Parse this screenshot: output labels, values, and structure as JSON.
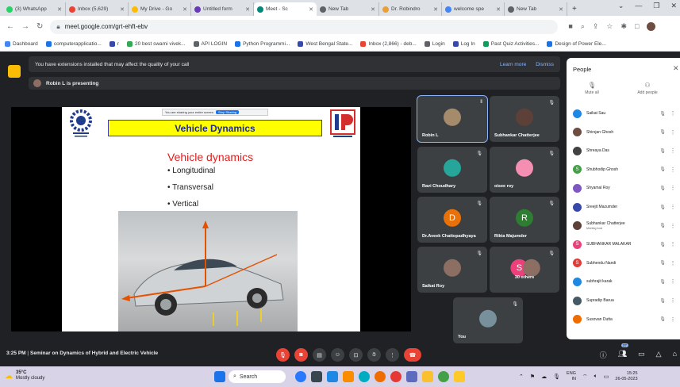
{
  "browser": {
    "tabs": [
      {
        "label": "(3) WhatsApp",
        "color": "#25d366"
      },
      {
        "label": "Inbox (5,629)",
        "color": "#ea4335"
      },
      {
        "label": "My Drive - Go",
        "color": "#fbbc04"
      },
      {
        "label": "Untitled form",
        "color": "#673ab7"
      },
      {
        "label": "Meet - Sc",
        "color": "#00897b",
        "active": true
      },
      {
        "label": "New Tab",
        "color": "#5f6368"
      },
      {
        "label": "Dr. Robindro",
        "color": "#e8a13a"
      },
      {
        "label": "welcome spe",
        "color": "#4285f4"
      },
      {
        "label": "New Tab",
        "color": "#5f6368"
      }
    ],
    "url": "meet.google.com/grt-ehft-ebv",
    "bookmarks": [
      {
        "label": "Dashboard",
        "color": "#4285f4"
      },
      {
        "label": "computerapplicatio...",
        "color": "#1a73e8"
      },
      {
        "label": "r",
        "color": "#3949ab"
      },
      {
        "label": "20 best swami vivek...",
        "color": "#34a853"
      },
      {
        "label": "API LOGIN",
        "color": "#5f6368"
      },
      {
        "label": "Python Programmi...",
        "color": "#1a73e8"
      },
      {
        "label": "West Bengal State...",
        "color": "#3949ab"
      },
      {
        "label": "Inbox (2,866) - deb...",
        "color": "#ea4335"
      },
      {
        "label": "Login",
        "color": "#5f6368"
      },
      {
        "label": "Log In",
        "color": "#3949ab"
      },
      {
        "label": "Past Quiz Activities...",
        "color": "#0f9d58"
      },
      {
        "label": "Design of Power Ele...",
        "color": "#1a73e8"
      }
    ]
  },
  "meet": {
    "warning": "You have extensions installed that may affect the quality of your call",
    "learn_more": "Learn more",
    "dismiss": "Dismiss",
    "presenting": "Robin L is presenting",
    "slide": {
      "banner": "Vehicle Dynamics",
      "title": "Vehicle dynamics",
      "bullets": [
        "Longitudinal",
        "Transversal",
        "Vertical"
      ],
      "share_text": "You are sharing your entire screen",
      "share_btn": "Stop Sharing"
    },
    "tiles": [
      {
        "name": "Robin L",
        "kind": "photo",
        "color": "#a58b6c"
      },
      {
        "name": "Subhankar Chatterjee",
        "kind": "photo",
        "color": "#5d4037"
      },
      {
        "name": "Ravi Choudhary",
        "kind": "photo",
        "color": "#26a69a"
      },
      {
        "name": "oisee roy",
        "kind": "photo",
        "color": "#f48fb1"
      },
      {
        "name": "Dr.Aveek Chattopadhyaya",
        "kind": "letter",
        "letter": "D",
        "color": "#e8710a"
      },
      {
        "name": "Rikta Majumder",
        "kind": "letter",
        "letter": "R",
        "color": "#2e7d32"
      },
      {
        "name": "Saikat Roy",
        "kind": "photo",
        "color": "#8d6e63"
      },
      {
        "name": "30 others",
        "kind": "others",
        "letter": "S",
        "color": "#ec407a"
      },
      {
        "name": "You",
        "kind": "photo",
        "color": "#78909c"
      }
    ],
    "clock": "3:25 PM",
    "meeting_title": "Seminar on Dynamics of Hybrid and Electric Vehicle",
    "people_count": "37"
  },
  "people": {
    "title": "People",
    "mute_all": "Mute all",
    "add_people": "Add people",
    "list": [
      {
        "name": "Saikat Sau",
        "color": "#1e88e5"
      },
      {
        "name": "Shirsjan Ghosh",
        "color": "#6d4c41"
      },
      {
        "name": "Shreaya Das",
        "color": "#424242"
      },
      {
        "name": "Shubhodip Ghosh",
        "color": "#43a047",
        "letter": "S"
      },
      {
        "name": "Shyamal Roy",
        "color": "#7e57c2"
      },
      {
        "name": "Sreejit Mazumder",
        "color": "#3949ab"
      },
      {
        "name": "Subhankar Chatterjee",
        "hint": "Meeting host",
        "color": "#5d4037"
      },
      {
        "name": "SUBHANKAR MALAKAR",
        "color": "#ec407a",
        "letter": "S"
      },
      {
        "name": "Subhendu Nandi",
        "color": "#e53935",
        "letter": "S"
      },
      {
        "name": "subhrajit karak",
        "color": "#1e88e5"
      },
      {
        "name": "Supradip Barua",
        "color": "#455a64"
      },
      {
        "name": "Susovan Dutta",
        "color": "#ef6c00"
      }
    ]
  },
  "taskbar": {
    "temp": "35°C",
    "weather": "Mostly cloudy",
    "search": "Search",
    "lang": "ENG",
    "region": "IN",
    "time": "15:25",
    "date": "26-05-2023"
  }
}
